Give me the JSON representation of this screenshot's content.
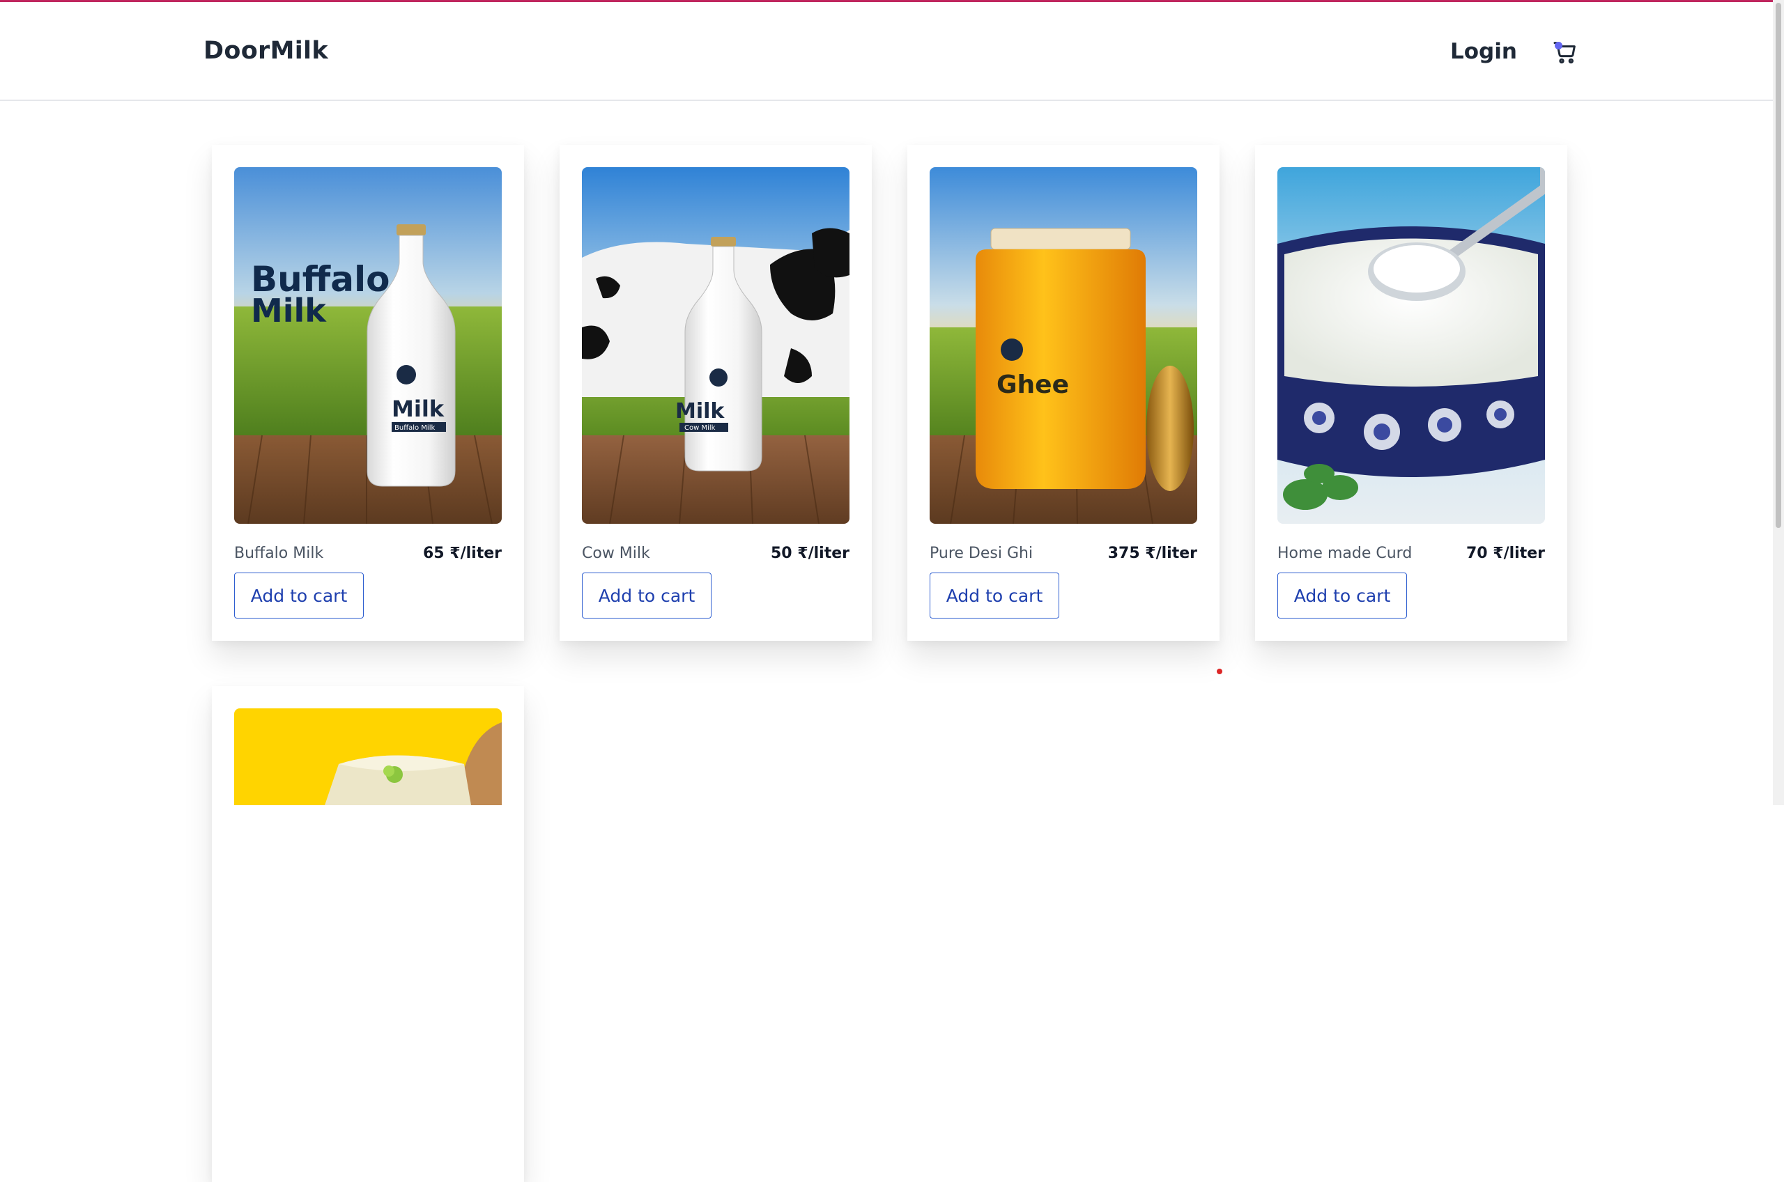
{
  "header": {
    "brand": "DoorMilk",
    "login_label": "Login",
    "cart_icon": "cart-icon"
  },
  "products": [
    {
      "name": "Buffalo Milk",
      "price": "65 ₹/liter",
      "button_label": "Add to cart",
      "image_text": {
        "headline_1": "Buffalo",
        "headline_2": "Milk",
        "label": "Milk",
        "sublabel": "Buffalo Milk"
      }
    },
    {
      "name": "Cow Milk",
      "price": "50 ₹/liter",
      "button_label": "Add to cart",
      "image_text": {
        "label": "Milk",
        "sublabel": "Cow Milk"
      }
    },
    {
      "name": "Pure Desi Ghi",
      "price": "375 ₹/liter",
      "button_label": "Add to cart",
      "image_text": {
        "label": "Ghee"
      }
    },
    {
      "name": "Home made Curd",
      "price": "70 ₹/liter",
      "button_label": "Add to cart"
    },
    {
      "name": "",
      "price": "",
      "button_label": ""
    }
  ],
  "colors": {
    "accent_bar": "#c0265e",
    "button_text": "#1e3fae",
    "button_border": "#2f5fd0",
    "cart_badge": "#6366f1"
  }
}
